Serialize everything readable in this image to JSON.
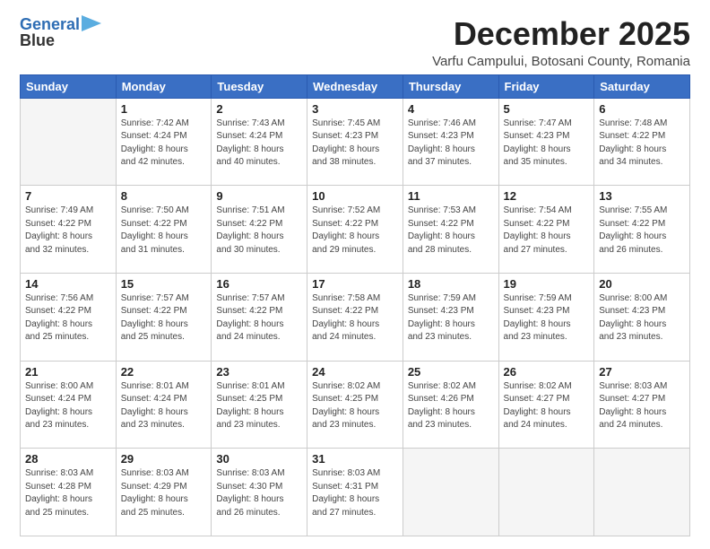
{
  "logo": {
    "line1": "General",
    "line2": "Blue"
  },
  "title": "December 2025",
  "subtitle": "Varfu Campului, Botosani County, Romania",
  "weekdays": [
    "Sunday",
    "Monday",
    "Tuesday",
    "Wednesday",
    "Thursday",
    "Friday",
    "Saturday"
  ],
  "weeks": [
    [
      {
        "day": "",
        "info": ""
      },
      {
        "day": "1",
        "info": "Sunrise: 7:42 AM\nSunset: 4:24 PM\nDaylight: 8 hours\nand 42 minutes."
      },
      {
        "day": "2",
        "info": "Sunrise: 7:43 AM\nSunset: 4:24 PM\nDaylight: 8 hours\nand 40 minutes."
      },
      {
        "day": "3",
        "info": "Sunrise: 7:45 AM\nSunset: 4:23 PM\nDaylight: 8 hours\nand 38 minutes."
      },
      {
        "day": "4",
        "info": "Sunrise: 7:46 AM\nSunset: 4:23 PM\nDaylight: 8 hours\nand 37 minutes."
      },
      {
        "day": "5",
        "info": "Sunrise: 7:47 AM\nSunset: 4:23 PM\nDaylight: 8 hours\nand 35 minutes."
      },
      {
        "day": "6",
        "info": "Sunrise: 7:48 AM\nSunset: 4:22 PM\nDaylight: 8 hours\nand 34 minutes."
      }
    ],
    [
      {
        "day": "7",
        "info": "Sunrise: 7:49 AM\nSunset: 4:22 PM\nDaylight: 8 hours\nand 32 minutes."
      },
      {
        "day": "8",
        "info": "Sunrise: 7:50 AM\nSunset: 4:22 PM\nDaylight: 8 hours\nand 31 minutes."
      },
      {
        "day": "9",
        "info": "Sunrise: 7:51 AM\nSunset: 4:22 PM\nDaylight: 8 hours\nand 30 minutes."
      },
      {
        "day": "10",
        "info": "Sunrise: 7:52 AM\nSunset: 4:22 PM\nDaylight: 8 hours\nand 29 minutes."
      },
      {
        "day": "11",
        "info": "Sunrise: 7:53 AM\nSunset: 4:22 PM\nDaylight: 8 hours\nand 28 minutes."
      },
      {
        "day": "12",
        "info": "Sunrise: 7:54 AM\nSunset: 4:22 PM\nDaylight: 8 hours\nand 27 minutes."
      },
      {
        "day": "13",
        "info": "Sunrise: 7:55 AM\nSunset: 4:22 PM\nDaylight: 8 hours\nand 26 minutes."
      }
    ],
    [
      {
        "day": "14",
        "info": "Sunrise: 7:56 AM\nSunset: 4:22 PM\nDaylight: 8 hours\nand 25 minutes."
      },
      {
        "day": "15",
        "info": "Sunrise: 7:57 AM\nSunset: 4:22 PM\nDaylight: 8 hours\nand 25 minutes."
      },
      {
        "day": "16",
        "info": "Sunrise: 7:57 AM\nSunset: 4:22 PM\nDaylight: 8 hours\nand 24 minutes."
      },
      {
        "day": "17",
        "info": "Sunrise: 7:58 AM\nSunset: 4:22 PM\nDaylight: 8 hours\nand 24 minutes."
      },
      {
        "day": "18",
        "info": "Sunrise: 7:59 AM\nSunset: 4:23 PM\nDaylight: 8 hours\nand 23 minutes."
      },
      {
        "day": "19",
        "info": "Sunrise: 7:59 AM\nSunset: 4:23 PM\nDaylight: 8 hours\nand 23 minutes."
      },
      {
        "day": "20",
        "info": "Sunrise: 8:00 AM\nSunset: 4:23 PM\nDaylight: 8 hours\nand 23 minutes."
      }
    ],
    [
      {
        "day": "21",
        "info": "Sunrise: 8:00 AM\nSunset: 4:24 PM\nDaylight: 8 hours\nand 23 minutes."
      },
      {
        "day": "22",
        "info": "Sunrise: 8:01 AM\nSunset: 4:24 PM\nDaylight: 8 hours\nand 23 minutes."
      },
      {
        "day": "23",
        "info": "Sunrise: 8:01 AM\nSunset: 4:25 PM\nDaylight: 8 hours\nand 23 minutes."
      },
      {
        "day": "24",
        "info": "Sunrise: 8:02 AM\nSunset: 4:25 PM\nDaylight: 8 hours\nand 23 minutes."
      },
      {
        "day": "25",
        "info": "Sunrise: 8:02 AM\nSunset: 4:26 PM\nDaylight: 8 hours\nand 23 minutes."
      },
      {
        "day": "26",
        "info": "Sunrise: 8:02 AM\nSunset: 4:27 PM\nDaylight: 8 hours\nand 24 minutes."
      },
      {
        "day": "27",
        "info": "Sunrise: 8:03 AM\nSunset: 4:27 PM\nDaylight: 8 hours\nand 24 minutes."
      }
    ],
    [
      {
        "day": "28",
        "info": "Sunrise: 8:03 AM\nSunset: 4:28 PM\nDaylight: 8 hours\nand 25 minutes."
      },
      {
        "day": "29",
        "info": "Sunrise: 8:03 AM\nSunset: 4:29 PM\nDaylight: 8 hours\nand 25 minutes."
      },
      {
        "day": "30",
        "info": "Sunrise: 8:03 AM\nSunset: 4:30 PM\nDaylight: 8 hours\nand 26 minutes."
      },
      {
        "day": "31",
        "info": "Sunrise: 8:03 AM\nSunset: 4:31 PM\nDaylight: 8 hours\nand 27 minutes."
      },
      {
        "day": "",
        "info": ""
      },
      {
        "day": "",
        "info": ""
      },
      {
        "day": "",
        "info": ""
      }
    ]
  ]
}
